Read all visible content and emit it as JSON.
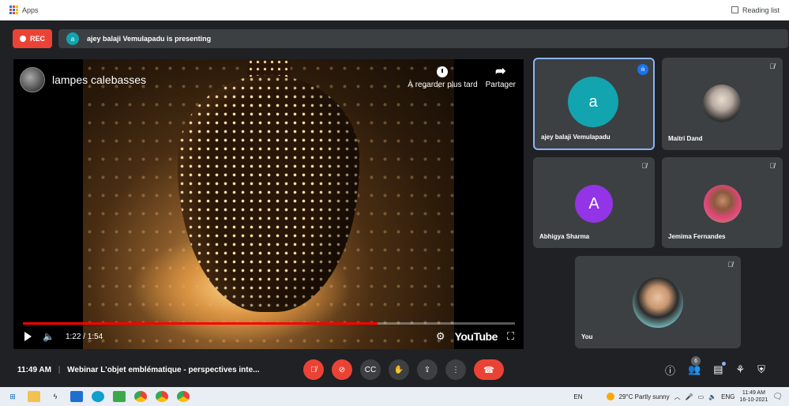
{
  "bookmarks": {
    "apps_label": "Apps",
    "reading_list_label": "Reading list"
  },
  "meet": {
    "rec_label": "REC",
    "presenting": {
      "avatar_letter": "a",
      "text": "ajey balaji Vemulapadu is presenting"
    },
    "video": {
      "title": "lampes calebasses",
      "watch_later_label": "À regarder plus tard",
      "share_label": "Partager",
      "time_label": "1:22 / 1:54",
      "progress": 0.72,
      "brand": "YouTube"
    },
    "participants": [
      {
        "name": "ajey balaji Vemulapadu",
        "avatar_letter": "a",
        "avatar_color": "#12a4af"
      },
      {
        "name": "Maitri Dand"
      },
      {
        "name": "Abhigya Sharma",
        "avatar_letter": "A",
        "avatar_color": "#9334e6"
      },
      {
        "name": "Jemima Fernandes"
      },
      {
        "name": "You"
      }
    ],
    "controls": {
      "time": "11:49 AM",
      "separator": "|",
      "meeting_title": "Webinar L'objet emblématique - perspectives inte...",
      "people_count": "6"
    }
  },
  "taskbar": {
    "language_short": "EN",
    "weather": "29°C  Partly sunny",
    "language": "ENG",
    "time": "11:49 AM",
    "date": "16-10-2021"
  },
  "colors": {
    "meet_bg": "#202124",
    "tile_bg": "#3c4043",
    "danger": "#ea4335",
    "accent": "#8ab4f8",
    "progress": "#ff0000"
  }
}
